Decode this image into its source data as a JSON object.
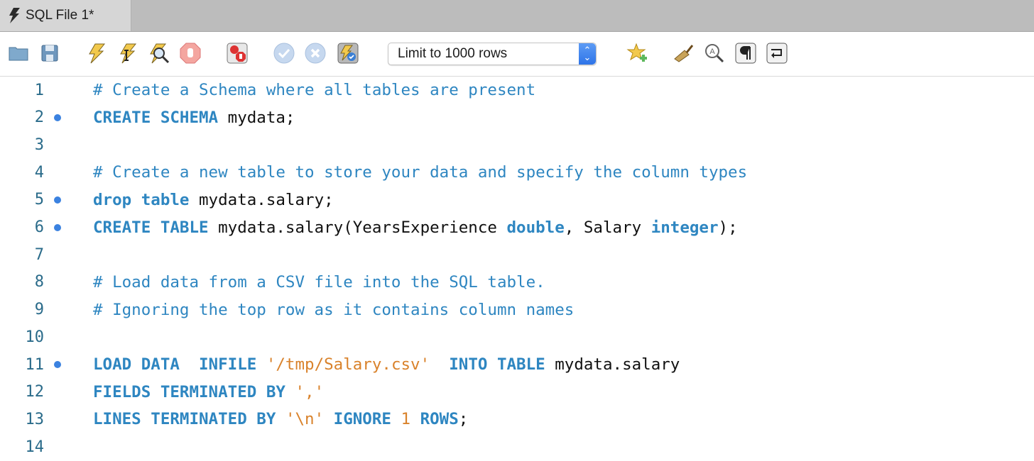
{
  "tab": {
    "label": "SQL File 1*",
    "icon": "lightning-bolt-icon"
  },
  "toolbar": {
    "buttons": [
      {
        "name": "open-file",
        "icon": "folder-icon"
      },
      {
        "name": "save",
        "icon": "floppy-disk-icon"
      },
      {
        "name": "execute-all",
        "icon": "lightning-bolt-icon"
      },
      {
        "name": "execute-current",
        "icon": "lightning-cursor-icon"
      },
      {
        "name": "explain",
        "icon": "lightning-magnifier-icon"
      },
      {
        "name": "stop",
        "icon": "stop-hand-icon"
      },
      {
        "name": "toggle-stop-on-error",
        "icon": "error-stop-icon"
      },
      {
        "name": "commit",
        "icon": "check-circle-icon"
      },
      {
        "name": "rollback",
        "icon": "x-circle-icon"
      },
      {
        "name": "autocommit",
        "icon": "lightning-check-icon"
      },
      {
        "name": "add-snippet",
        "icon": "star-plus-icon"
      },
      {
        "name": "beautify",
        "icon": "broom-icon"
      },
      {
        "name": "find",
        "icon": "find-magnifier-icon"
      },
      {
        "name": "toggle-invisibles",
        "icon": "pilcrow-icon"
      },
      {
        "name": "toggle-wrap",
        "icon": "word-wrap-icon"
      }
    ],
    "limit_select": {
      "value": "Limit to 1000 rows"
    }
  },
  "editor": {
    "lines": [
      {
        "n": "1",
        "dot": false,
        "tokens": [
          {
            "t": "cm",
            "v": "# Create a Schema where all tables are present"
          }
        ]
      },
      {
        "n": "2",
        "dot": true,
        "tokens": [
          {
            "t": "kw",
            "v": "CREATE SCHEMA"
          },
          {
            "t": "id",
            "v": " mydata;"
          }
        ]
      },
      {
        "n": "3",
        "dot": false,
        "tokens": []
      },
      {
        "n": "4",
        "dot": false,
        "tokens": [
          {
            "t": "cm",
            "v": "# Create a new table to store your data and specify the column types"
          }
        ]
      },
      {
        "n": "5",
        "dot": true,
        "tokens": [
          {
            "t": "kw",
            "v": "drop table"
          },
          {
            "t": "id",
            "v": " mydata.salary;"
          }
        ]
      },
      {
        "n": "6",
        "dot": true,
        "tokens": [
          {
            "t": "kw",
            "v": "CREATE TABLE"
          },
          {
            "t": "id",
            "v": " mydata.salary(YearsExperience "
          },
          {
            "t": "kw",
            "v": "double"
          },
          {
            "t": "id",
            "v": ", Salary "
          },
          {
            "t": "kw",
            "v": "integer"
          },
          {
            "t": "id",
            "v": ");"
          }
        ]
      },
      {
        "n": "7",
        "dot": false,
        "tokens": []
      },
      {
        "n": "8",
        "dot": false,
        "tokens": [
          {
            "t": "cm",
            "v": "# Load data from a CSV file into the SQL table."
          }
        ]
      },
      {
        "n": "9",
        "dot": false,
        "tokens": [
          {
            "t": "cm",
            "v": "# Ignoring the top row as it contains column names"
          }
        ]
      },
      {
        "n": "10",
        "dot": false,
        "tokens": []
      },
      {
        "n": "11",
        "dot": true,
        "tokens": [
          {
            "t": "kw",
            "v": "LOAD DATA  INFILE"
          },
          {
            "t": "id",
            "v": " "
          },
          {
            "t": "st",
            "v": "'/tmp/Salary.csv'"
          },
          {
            "t": "id",
            "v": "  "
          },
          {
            "t": "kw",
            "v": "INTO TABLE"
          },
          {
            "t": "id",
            "v": " mydata.salary"
          }
        ]
      },
      {
        "n": "12",
        "dot": false,
        "tokens": [
          {
            "t": "kw",
            "v": "FIELDS TERMINATED BY"
          },
          {
            "t": "id",
            "v": " "
          },
          {
            "t": "st",
            "v": "','"
          }
        ]
      },
      {
        "n": "13",
        "dot": false,
        "tokens": [
          {
            "t": "kw",
            "v": "LINES TERMINATED BY"
          },
          {
            "t": "id",
            "v": " "
          },
          {
            "t": "st",
            "v": "'\\n'"
          },
          {
            "t": "id",
            "v": " "
          },
          {
            "t": "kw",
            "v": "IGNORE"
          },
          {
            "t": "id",
            "v": " "
          },
          {
            "t": "nm",
            "v": "1"
          },
          {
            "t": "id",
            "v": " "
          },
          {
            "t": "kw",
            "v": "ROWS"
          },
          {
            "t": "id",
            "v": ";"
          }
        ]
      },
      {
        "n": "14",
        "dot": false,
        "tokens": []
      }
    ]
  }
}
